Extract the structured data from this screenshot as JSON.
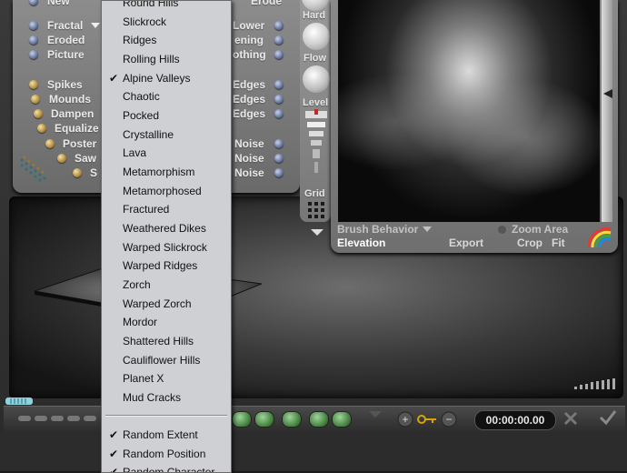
{
  "left_panel": {
    "rows_left": [
      {
        "label": "New"
      },
      {
        "label": "Fractal"
      },
      {
        "label": "Eroded"
      },
      {
        "label": "Picture"
      },
      {
        "label": "Spikes"
      },
      {
        "label": "Mounds"
      },
      {
        "label": "Dampen"
      },
      {
        "label": "Equalize"
      },
      {
        "label": "Poster"
      },
      {
        "label": "Saw"
      },
      {
        "label": "S"
      }
    ],
    "rows_right": [
      {
        "label": "Erode"
      },
      {
        "label": "Lower"
      },
      {
        "label": "ening"
      },
      {
        "label": "othing"
      },
      {
        "label": "Edges"
      },
      {
        "label": "Edges"
      },
      {
        "label": "Edges"
      },
      {
        "label": "Noise"
      },
      {
        "label": "Noise"
      },
      {
        "label": "Noise"
      }
    ]
  },
  "control_strip": {
    "hard": "Hard",
    "flow": "Flow",
    "level": "Level",
    "grid": "Grid"
  },
  "preview": {
    "brush_behavior": "Brush Behavior",
    "zoom_area": "Zoom Area",
    "elevation": "Elevation",
    "export": "Export",
    "crop": "Crop",
    "fit": "Fit"
  },
  "transport": {
    "time": "00:00:00.00"
  },
  "menu": {
    "items": [
      {
        "label": "Round Hills",
        "checked": false
      },
      {
        "label": "Slickrock",
        "checked": false
      },
      {
        "label": "Ridges",
        "checked": false
      },
      {
        "label": "Rolling Hills",
        "checked": false
      },
      {
        "label": "Alpine Valleys",
        "checked": true
      },
      {
        "label": "Chaotic",
        "checked": false
      },
      {
        "label": "Pocked",
        "checked": false
      },
      {
        "label": "Crystalline",
        "checked": false
      },
      {
        "label": "Lava",
        "checked": false
      },
      {
        "label": "Metamorphism",
        "checked": false
      },
      {
        "label": "Metamorphosed",
        "checked": false
      },
      {
        "label": "Fractured",
        "checked": false
      },
      {
        "label": "Weathered Dikes",
        "checked": false
      },
      {
        "label": "Warped Slickrock",
        "checked": false
      },
      {
        "label": "Warped Ridges",
        "checked": false
      },
      {
        "label": "Zorch",
        "checked": false
      },
      {
        "label": "Warped Zorch",
        "checked": false
      },
      {
        "label": "Mordor",
        "checked": false
      },
      {
        "label": "Shattered Hills",
        "checked": false
      },
      {
        "label": "Cauliflower Hills",
        "checked": false
      },
      {
        "label": "Planet X",
        "checked": false
      },
      {
        "label": "Mud Cracks",
        "checked": false
      }
    ],
    "options": [
      {
        "label": "Random Extent",
        "checked": true
      },
      {
        "label": "Random Position",
        "checked": true
      },
      {
        "label": "Random Character",
        "checked": true
      }
    ],
    "check_glyph": "✔"
  }
}
